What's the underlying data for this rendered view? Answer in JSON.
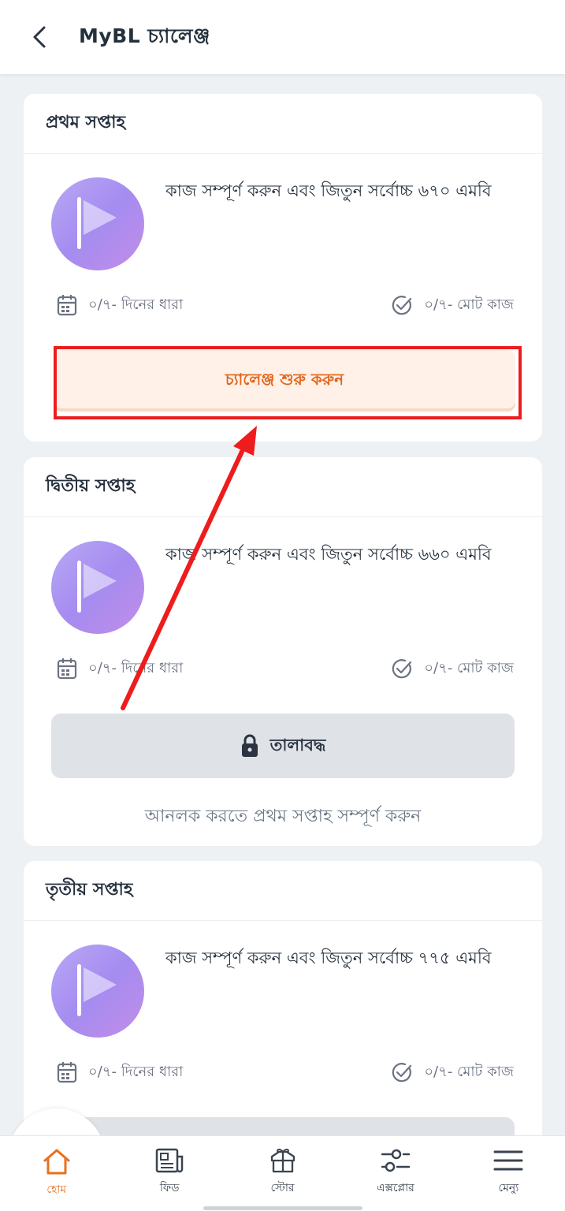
{
  "header": {
    "title": "MyBL চ্যালেঞ্জ"
  },
  "weeks": [
    {
      "title": "প্রথম সপ্তাহ",
      "description": "কাজ সম্পূর্ণ করুন এবং জিতুন সর্বোচ্চ ৬৭০ এমবি",
      "streak": "০/৭- দিনের ধারা",
      "tasks": "০/৭- মোট কাজ",
      "button_label": "চ্যালেঞ্জ শুরু করুন"
    },
    {
      "title": "দ্বিতীয় সপ্তাহ",
      "description": "কাজ সম্পূর্ণ করুন এবং জিতুন সর্বোচ্চ ৬৬০ এমবি",
      "streak": "০/৭- দিনের ধারা",
      "tasks": "০/৭- মোট কাজ",
      "button_label": "তালাবদ্ধ",
      "unlock_hint": "আনলক করতে প্রথম সপ্তাহ সম্পূর্ণ করুন"
    },
    {
      "title": "তৃতীয় সপ্তাহ",
      "description": "কাজ সম্পূর্ণ করুন এবং জিতুন সর্বোচ্চ ৭৭৫ এমবি",
      "streak": "০/৭- দিনের ধারা",
      "tasks": "০/৭- মোট কাজ"
    }
  ],
  "bottom_nav": [
    {
      "label": "হোম",
      "icon": "home-icon",
      "active": true
    },
    {
      "label": "ফিড",
      "icon": "newspaper-icon",
      "active": false
    },
    {
      "label": "স্টোর",
      "icon": "gift-box-icon",
      "active": false
    },
    {
      "label": "এক্সপ্লোর",
      "icon": "sliders-icon",
      "active": false
    },
    {
      "label": "মেন্যু",
      "icon": "menu-icon",
      "active": false
    }
  ],
  "colors": {
    "accent": "#e8701e",
    "annotation": "#ee1c1c",
    "avatar_gradient": [
      "#b9a8f5",
      "#c28de8"
    ]
  }
}
